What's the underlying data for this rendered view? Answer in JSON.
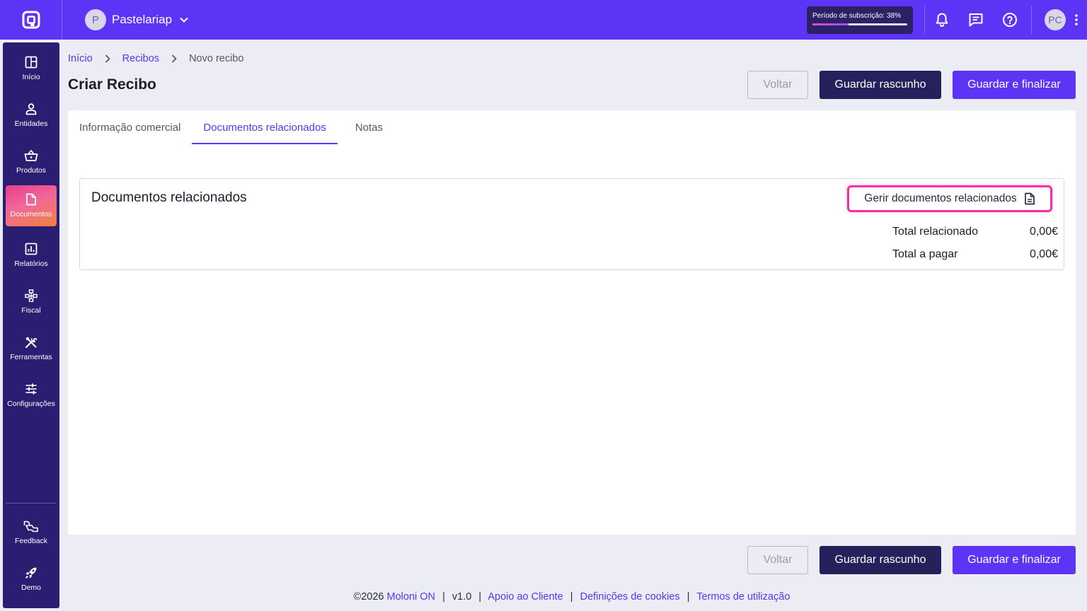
{
  "topbar": {
    "company_initial": "P",
    "company_name": "Pastelariap",
    "subscription_label": "Período de subscrição: 38%",
    "subscription_progress": 0.38,
    "user_initials": "PC"
  },
  "sidebar": {
    "items": [
      {
        "label": "Início",
        "icon": "grid-icon"
      },
      {
        "label": "Entidades",
        "icon": "person-icon"
      },
      {
        "label": "Produtos",
        "icon": "basket-icon"
      },
      {
        "label": "Documentos",
        "icon": "document-icon",
        "active": true
      },
      {
        "label": "Relatórios",
        "icon": "chart-icon"
      },
      {
        "label": "Fiscal",
        "icon": "hierarchy-icon"
      },
      {
        "label": "Ferramentas",
        "icon": "tools-icon"
      },
      {
        "label": "Configurações",
        "icon": "sliders-icon"
      }
    ],
    "bottom_items": [
      {
        "label": "Feedback",
        "icon": "feedback-icon"
      },
      {
        "label": "Demo",
        "icon": "rocket-icon"
      }
    ]
  },
  "breadcrumb": {
    "home": "Início",
    "receipts": "Recibos",
    "current": "Novo recibo"
  },
  "page": {
    "title": "Criar Recibo"
  },
  "actions": {
    "back": "Voltar",
    "save_draft": "Guardar rascunho",
    "save_finalize": "Guardar e finalizar"
  },
  "tabs": [
    {
      "label": "Informação comercial"
    },
    {
      "label": "Documentos relacionados",
      "active": true
    },
    {
      "label": "Notas"
    }
  ],
  "related": {
    "title": "Documentos relacionados",
    "manage_label": "Gerir documentos relacionados",
    "total_related_label": "Total relacionado",
    "total_related_value": "0,00€",
    "total_pay_label": "Total a pagar",
    "total_pay_value": "0,00€"
  },
  "footer": {
    "copyright": "©2026",
    "brand": "Moloni ON",
    "version": "v1.0",
    "support": "Apoio ao Cliente",
    "cookies": "Definições de cookies",
    "terms": "Termos de utilização"
  },
  "colors": {
    "brand": "#5b34f5",
    "sidebar": "#2a1e72",
    "dark_button": "#26205c",
    "highlight": "#f52fa8"
  }
}
